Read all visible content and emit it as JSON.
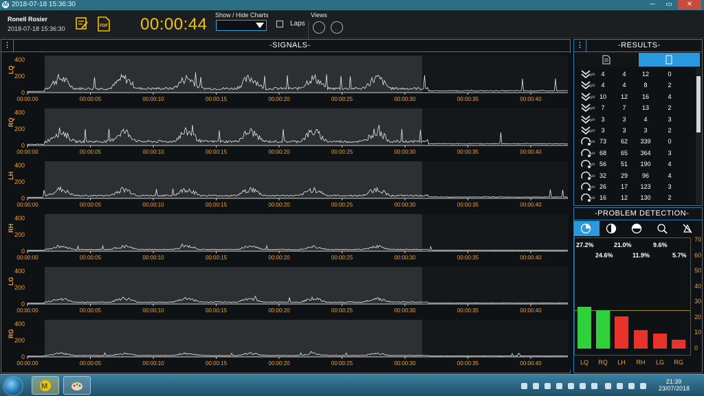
{
  "window": {
    "title": "2018-07-18 15:36:30"
  },
  "header": {
    "user_name": "Ronell Rosier",
    "session_date": "2018-07-18 15:36:30",
    "timer": "00:00:44",
    "show_hide_label": "Show / Hide Charts",
    "laps_label": "Laps",
    "views_label": "Views"
  },
  "signals_panel": {
    "title": "-SIGNALS-",
    "menu_glyph": "⋮"
  },
  "results_panel": {
    "title": "-RESULTS-",
    "menu_glyph": "⋮"
  },
  "problem_panel": {
    "title": "-PROBLEM DETECTION-"
  },
  "x_ticks": [
    "00:00:00",
    "00:00:05",
    "00:00:10",
    "00:00:15",
    "00:00:20",
    "00:00:25",
    "00:00:30",
    "00:00:35",
    "00:00:40"
  ],
  "y_ticks": [
    "400",
    "200",
    "0"
  ],
  "signals": [
    {
      "name": "LQ",
      "amp": 1.0
    },
    {
      "name": "RQ",
      "amp": 0.95
    },
    {
      "name": "LH",
      "amp": 0.6
    },
    {
      "name": "RH",
      "amp": 0.3
    },
    {
      "name": "LG",
      "amp": 0.35
    },
    {
      "name": "RG",
      "amp": 0.2
    }
  ],
  "results_rows": [
    {
      "icon": "chevron",
      "unit": "μv",
      "values": [
        "4",
        "4",
        "12",
        "0"
      ]
    },
    {
      "icon": "chevron",
      "unit": "μv",
      "values": [
        "4",
        "4",
        "8",
        "2"
      ]
    },
    {
      "icon": "chevron",
      "unit": "μv",
      "values": [
        "10",
        "12",
        "16",
        "4"
      ]
    },
    {
      "icon": "chevron",
      "unit": "μv",
      "values": [
        "7",
        "7",
        "13",
        "2"
      ]
    },
    {
      "icon": "chevron",
      "unit": "μv",
      "values": [
        "3",
        "3",
        "4",
        "3"
      ]
    },
    {
      "icon": "chevron",
      "unit": "μv",
      "values": [
        "3",
        "3",
        "3",
        "2"
      ]
    },
    {
      "icon": "gauge",
      "unit": "μv",
      "values": [
        "73",
        "62",
        "339",
        "0"
      ]
    },
    {
      "icon": "gauge",
      "unit": "μv",
      "values": [
        "68",
        "65",
        "364",
        "3"
      ]
    },
    {
      "icon": "gauge",
      "unit": "μv",
      "values": [
        "56",
        "51",
        "190",
        "4"
      ]
    },
    {
      "icon": "gauge",
      "unit": "μv",
      "values": [
        "32",
        "29",
        "96",
        "4"
      ]
    },
    {
      "icon": "gauge",
      "unit": "μv",
      "values": [
        "26",
        "17",
        "123",
        "3"
      ]
    },
    {
      "icon": "gauge",
      "unit": "μv",
      "values": [
        "16",
        "12",
        "130",
        "2"
      ]
    }
  ],
  "colors": {
    "accent": "#2a9ae0",
    "timer": "#f3c200",
    "axis_label": "#f0a030",
    "green": "#2fd13a",
    "red": "#e8322a"
  },
  "chart_data": {
    "type": "bar",
    "categories": [
      "LQ",
      "RQ",
      "LH",
      "RH",
      "LG",
      "RG"
    ],
    "values": [
      27.2,
      24.6,
      21.0,
      11.9,
      9.6,
      5.7
    ],
    "value_labels": [
      "27.2%",
      "24.6%",
      "21.0%",
      "11.9%",
      "9.6%",
      "5.7%"
    ],
    "colors": [
      "#2fd13a",
      "#2fd13a",
      "#e8322a",
      "#e8322a",
      "#e8322a",
      "#e8322a"
    ],
    "ylim": [
      0,
      70
    ],
    "y_ticks": [
      "0",
      "10",
      "20",
      "30",
      "40",
      "50",
      "60",
      "70"
    ],
    "threshold": 25
  },
  "taskbar": {
    "time": "21:39",
    "date": "23/07/2018"
  }
}
